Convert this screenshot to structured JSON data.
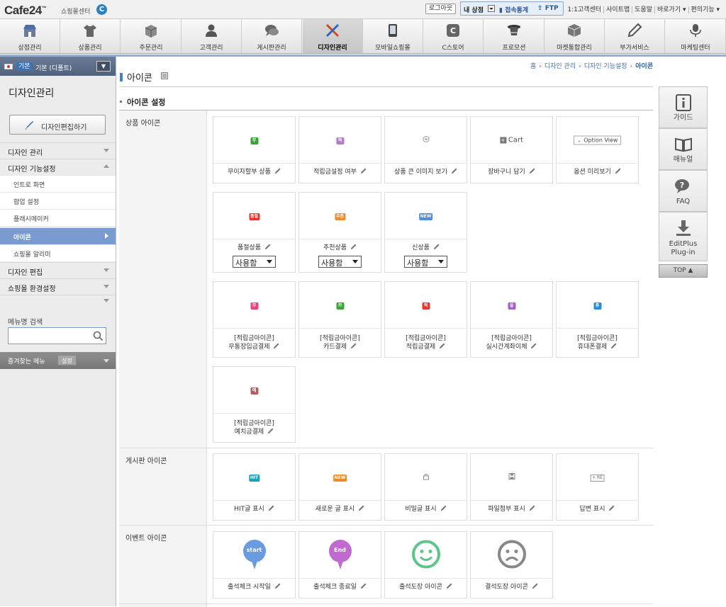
{
  "topbar": {
    "logo": "Cafe24",
    "logo_tm": "™",
    "logo_sub": "쇼핑몰센터",
    "logo_c": "C",
    "logout": "로그아웃",
    "my_store": "내 상점",
    "stats": "접속통계",
    "ftp": "FTP",
    "links": [
      "1:1고객센터",
      "사이트맵",
      "도움말",
      "바로가기 ▾",
      "편의기능 ▾"
    ]
  },
  "nav": {
    "tabs": [
      {
        "label": "상점관리",
        "icon": "store-icon"
      },
      {
        "label": "상품관리",
        "icon": "shirt-icon"
      },
      {
        "label": "주문관리",
        "icon": "box-icon"
      },
      {
        "label": "고객관리",
        "icon": "person-icon"
      },
      {
        "label": "게시판관리",
        "icon": "chat-icon"
      },
      {
        "label": "디자인관리",
        "icon": "design-tools-icon"
      },
      {
        "label": "모바일쇼핑몰",
        "icon": "mobile-icon"
      },
      {
        "label": "C스토어",
        "icon": "cstore-icon"
      },
      {
        "label": "프로모션",
        "icon": "hat-icon"
      },
      {
        "label": "마켓통합관리",
        "icon": "cube-icon"
      },
      {
        "label": "부가서비스",
        "icon": "pen-icon"
      },
      {
        "label": "마케팅센터",
        "icon": "microphone-icon"
      }
    ],
    "active_index": 5
  },
  "sidebar": {
    "store_tag": "기본",
    "store_name": "기본 (디폴트)",
    "title": "디자인관리",
    "edit_button": "디자인편집하기",
    "menus": [
      {
        "label": "디자인 관리",
        "expanded": false
      },
      {
        "label": "디자인 기능설정",
        "expanded": true
      }
    ],
    "submenu": [
      "인트로 화면",
      "팝업 설정",
      "플래시메이커",
      "아이콘",
      "쇼핑몰 알리미"
    ],
    "active_sub": "아이콘",
    "menus_after": [
      {
        "label": "디자인 편집"
      },
      {
        "label": "쇼핑몰 환경설정"
      }
    ],
    "search_label": "메뉴명 검색",
    "search_value": "",
    "favorites_label": "즐겨찾는 메뉴",
    "favorites_set": "설정"
  },
  "page": {
    "title": "아이콘",
    "breadcrumb": [
      "홈",
      "디자인 관리",
      "디자인 기능설정",
      "아이콘"
    ],
    "section_title": "아이콘 설정"
  },
  "rows": {
    "product": {
      "label": "상품 아이콘",
      "cards": [
        {
          "l1": "무이자할부 상품",
          "icon": "무",
          "color": "#3aa435"
        },
        {
          "l1": "적립금설정 여부",
          "icon": "적",
          "color": "#b07cc6"
        },
        {
          "l1": "상품 큰 이미지 보기",
          "icon": "zoom-icon",
          "color": "#999999"
        },
        {
          "l1": "장바구니 담기",
          "icon": "Cart",
          "color": "#777777"
        },
        {
          "l1": "옵션 미리보기",
          "icon": "Option View",
          "color": "#5a7bb0"
        }
      ],
      "cards2": [
        {
          "l1": "품절상품",
          "icon": "품절",
          "color": "#e8352e",
          "select": "사용함"
        },
        {
          "l1": "추천상품",
          "icon": "추천",
          "color": "#f08b2a",
          "select": "사용함"
        },
        {
          "l1": "신상품",
          "icon": "NEW",
          "color": "#4a90e2",
          "select": "사용함"
        }
      ],
      "cards3": [
        {
          "l1": "[적립금아이콘]",
          "l2": "무통장입금결제",
          "icon": "무",
          "color": "#e8457a"
        },
        {
          "l1": "[적립금아이콘]",
          "l2": "카드결제",
          "icon": "카",
          "color": "#3aa435"
        },
        {
          "l1": "[적립금아이콘]",
          "l2": "적립금결제",
          "icon": "적",
          "color": "#e8352e"
        },
        {
          "l1": "[적립금아이콘]",
          "l2": "실시간계좌이체",
          "icon": "실",
          "color": "#a560c7"
        },
        {
          "l1": "[적립금아이콘]",
          "l2": "휴대폰결제",
          "icon": "휴",
          "color": "#2a8ad4"
        }
      ],
      "cards4": [
        {
          "l1": "[적립금아이콘]",
          "l2": "예치금결제",
          "icon": "예",
          "color": "#b06060"
        }
      ]
    },
    "board": {
      "label": "게시판 아이콘",
      "cards": [
        {
          "l1": "HIT글 표시",
          "icon": "HIT",
          "color": "#17a2b8"
        },
        {
          "l1": "새로운 글 표시",
          "icon": "NEW",
          "color": "#f08b2a"
        },
        {
          "l1": "비밀글 표시",
          "icon": "lock-icon",
          "color": "#888888"
        },
        {
          "l1": "파일첨부 표시",
          "icon": "file-icon",
          "color": "#888888"
        },
        {
          "l1": "답변 표시",
          "icon": "+ RE",
          "color": "#666666"
        }
      ]
    },
    "event": {
      "label": "이벤트 아이콘",
      "cards": [
        {
          "l1": "출석체크 시작일",
          "icon": "start",
          "color": "#6a9be0"
        },
        {
          "l1": "출석체크 종료일",
          "icon": "End",
          "color": "#c06ad0"
        },
        {
          "l1": "출석도장 아이콘",
          "icon": "smile-icon",
          "color": "#5cc58a"
        },
        {
          "l1": "결석도장 아이콘",
          "icon": "sad-icon",
          "color": "#888888"
        }
      ]
    }
  },
  "right_panel": {
    "items": [
      {
        "label": "가이드",
        "icon": "info-icon"
      },
      {
        "label": "매뉴얼",
        "icon": "book-icon"
      },
      {
        "label": "FAQ",
        "icon": "faq-icon"
      },
      {
        "label": "EditPlus Plug-in",
        "icon": "download-icon"
      }
    ],
    "top": "TOP ▲"
  }
}
